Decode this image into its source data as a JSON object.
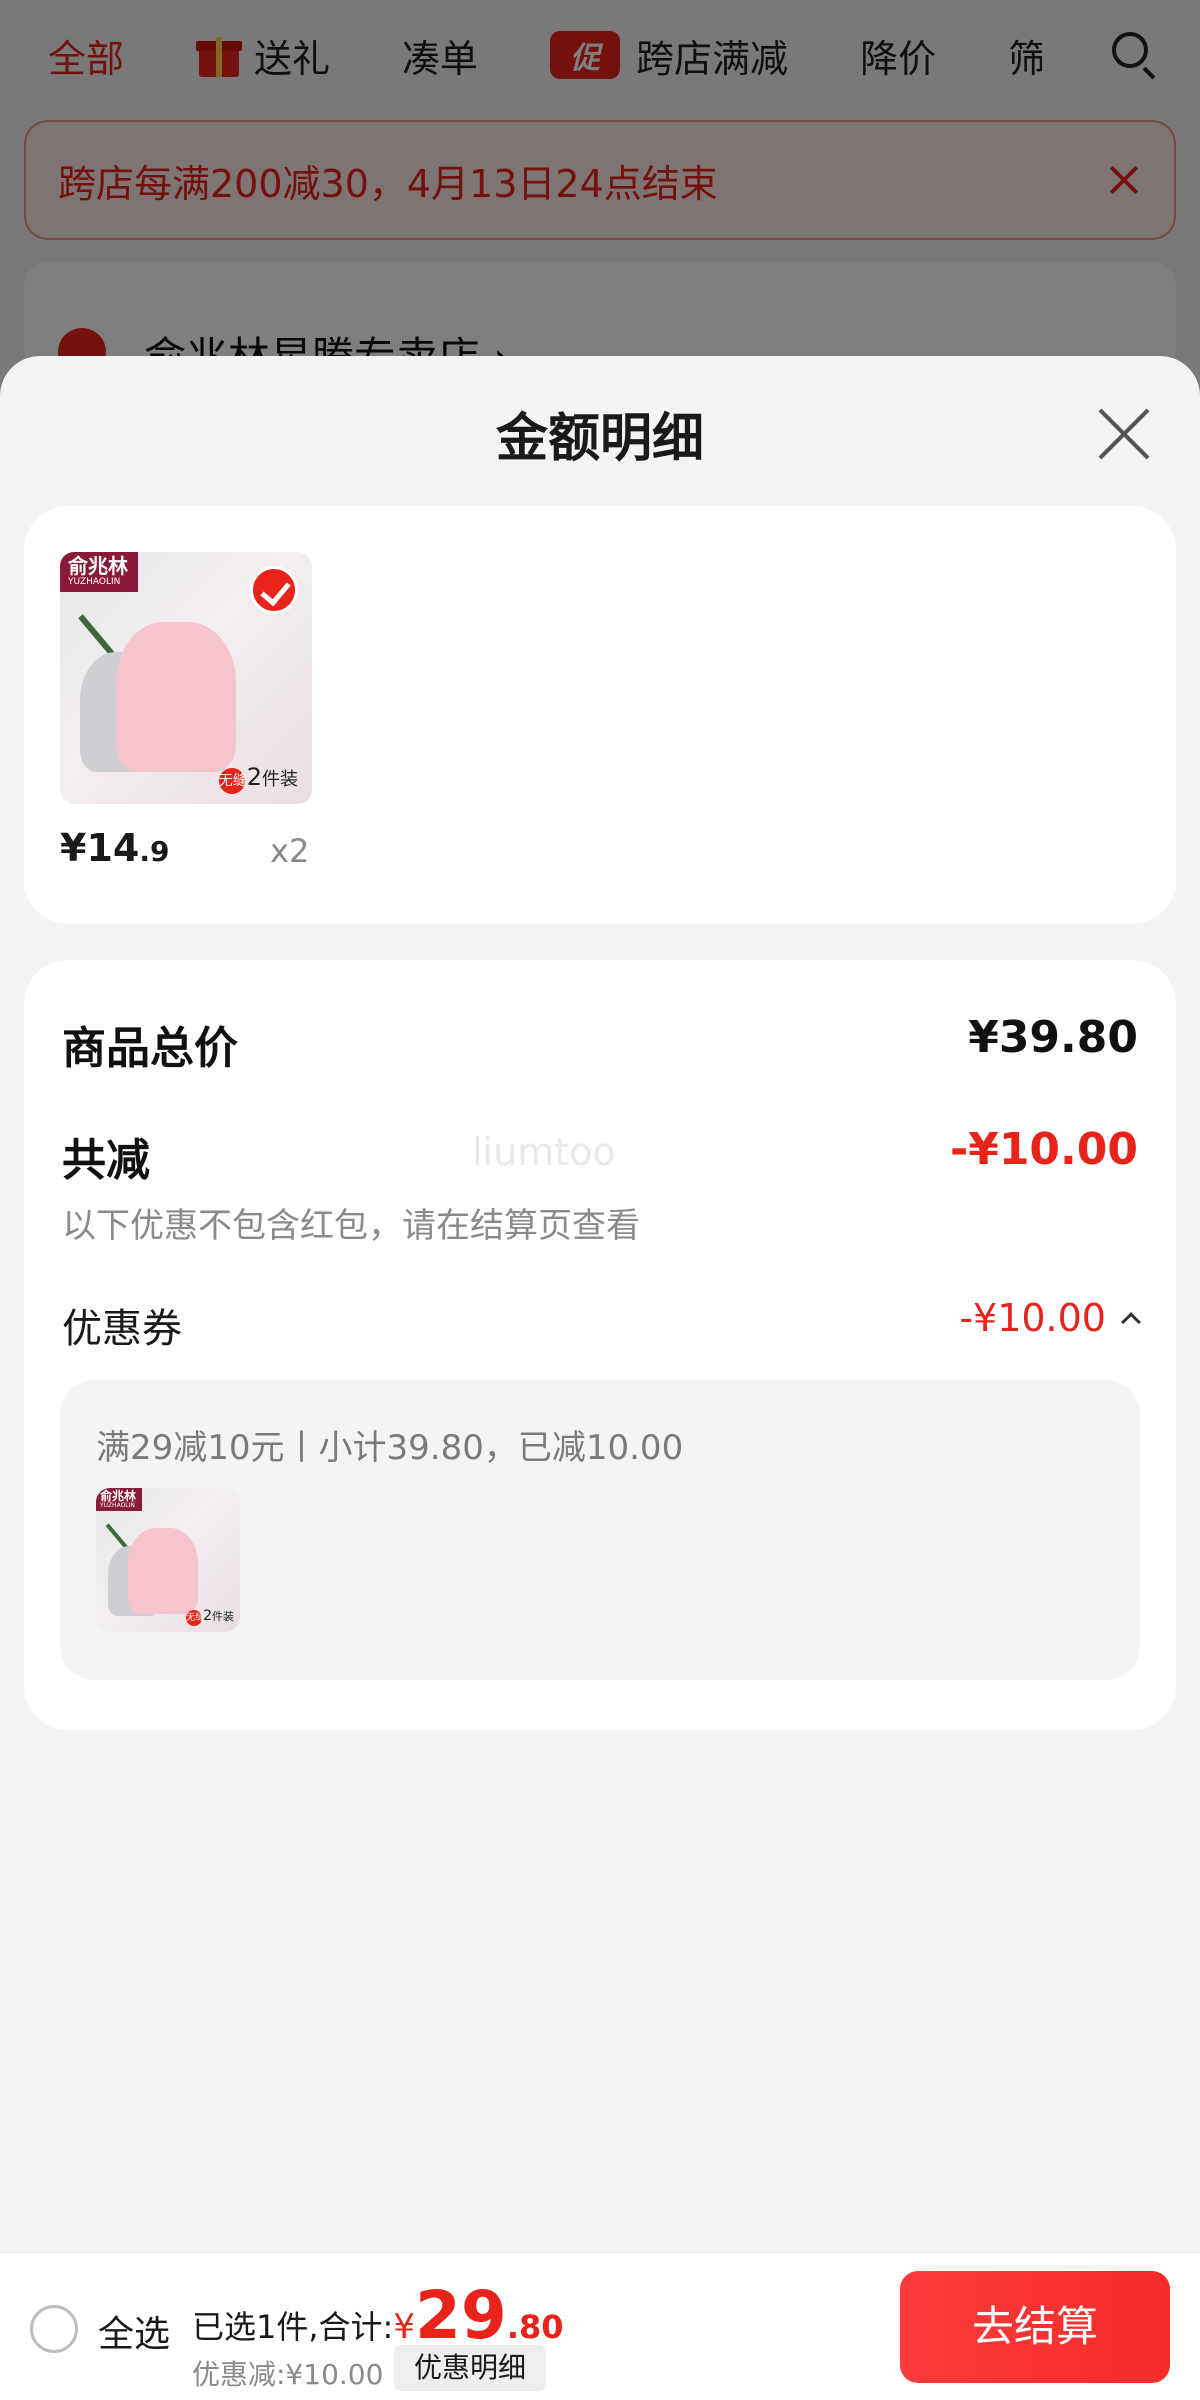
{
  "tabs": [
    {
      "label": "全部",
      "icon": "",
      "active": true
    },
    {
      "label": "送礼",
      "icon": "gift-icon"
    },
    {
      "label": "凑单",
      "icon": ""
    },
    {
      "label": "跨店满减",
      "icon": "promo-icon",
      "icon_text": "促"
    },
    {
      "label": "降价",
      "icon": ""
    },
    {
      "label": "筛",
      "icon": ""
    }
  ],
  "notice": {
    "text": "跨店每满200减30，4月13日24点结束"
  },
  "store": {
    "name": "俞兆林星腾专卖店 ›"
  },
  "sheet": {
    "title": "金额明细",
    "item": {
      "brand": "俞兆林",
      "brand_en": "YUZHAOLIN",
      "pack_badge": "无缝",
      "pack_num": "2",
      "pack_unit": "件装",
      "price_int": "¥14",
      "price_dec": ".9",
      "qty": "x2"
    },
    "summary": {
      "total_label": "商品总价",
      "total_value": "¥39.80",
      "reduce_label": "共减",
      "reduce_value": "-¥10.00",
      "watermark": "liumtoo",
      "note": "以下优惠不包含红包，请在结算页查看",
      "coupon_label": "优惠券",
      "coupon_value": "-¥10.00",
      "coupon_desc": "满29减10元丨小计39.80，已减10.00"
    }
  },
  "bottom": {
    "select_all": "全选",
    "summary_prefix": "已选1件,合计:",
    "yen": "¥",
    "total_int": "29",
    "total_dec": ".80",
    "discount_text": "优惠减:¥10.00",
    "detail_btn": "优惠明细",
    "checkout": "去结算"
  },
  "colors": {
    "accent": "#e8231a",
    "checkout": "#f62a2a"
  }
}
